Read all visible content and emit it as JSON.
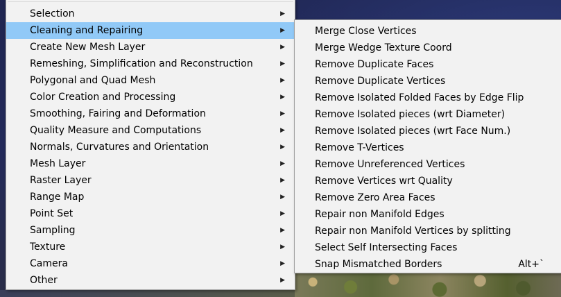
{
  "colors": {
    "menu_background": "#f2f2f2",
    "highlight": "#91c9f7",
    "viewport_background": "#1e2448"
  },
  "main_menu": {
    "items": [
      {
        "label": "Selection",
        "has_submenu": true
      },
      {
        "label": "Cleaning and Repairing",
        "has_submenu": true,
        "highlighted": true
      },
      {
        "label": "Create New Mesh Layer",
        "has_submenu": true
      },
      {
        "label": "Remeshing, Simplification and Reconstruction",
        "has_submenu": true
      },
      {
        "label": "Polygonal and Quad Mesh",
        "has_submenu": true
      },
      {
        "label": "Color Creation and Processing",
        "has_submenu": true
      },
      {
        "label": "Smoothing, Fairing and Deformation",
        "has_submenu": true
      },
      {
        "label": "Quality Measure and Computations",
        "has_submenu": true
      },
      {
        "label": "Normals, Curvatures and Orientation",
        "has_submenu": true
      },
      {
        "label": "Mesh Layer",
        "has_submenu": true
      },
      {
        "label": "Raster Layer",
        "has_submenu": true
      },
      {
        "label": "Range Map",
        "has_submenu": true
      },
      {
        "label": "Point Set",
        "has_submenu": true
      },
      {
        "label": "Sampling",
        "has_submenu": true
      },
      {
        "label": "Texture",
        "has_submenu": true
      },
      {
        "label": "Camera",
        "has_submenu": true
      },
      {
        "label": "Other",
        "has_submenu": true
      }
    ],
    "submenu_arrow_icon": "chevron-right-icon"
  },
  "sub_menu": {
    "items": [
      {
        "label": "Merge Close Vertices",
        "shortcut": ""
      },
      {
        "label": "Merge Wedge Texture Coord",
        "shortcut": ""
      },
      {
        "label": "Remove Duplicate Faces",
        "shortcut": ""
      },
      {
        "label": "Remove Duplicate Vertices",
        "shortcut": ""
      },
      {
        "label": "Remove Isolated Folded Faces by Edge Flip",
        "shortcut": ""
      },
      {
        "label": "Remove Isolated pieces (wrt Diameter)",
        "shortcut": ""
      },
      {
        "label": "Remove Isolated pieces (wrt Face Num.)",
        "shortcut": ""
      },
      {
        "label": "Remove T-Vertices",
        "shortcut": ""
      },
      {
        "label": "Remove Unreferenced Vertices",
        "shortcut": ""
      },
      {
        "label": "Remove Vertices wrt Quality",
        "shortcut": ""
      },
      {
        "label": "Remove Zero Area Faces",
        "shortcut": ""
      },
      {
        "label": "Repair non Manifold Edges",
        "shortcut": ""
      },
      {
        "label": "Repair non Manifold Vertices by splitting",
        "shortcut": ""
      },
      {
        "label": "Select Self Intersecting Faces",
        "shortcut": ""
      },
      {
        "label": "Snap Mismatched Borders",
        "shortcut": "Alt+`"
      }
    ]
  }
}
